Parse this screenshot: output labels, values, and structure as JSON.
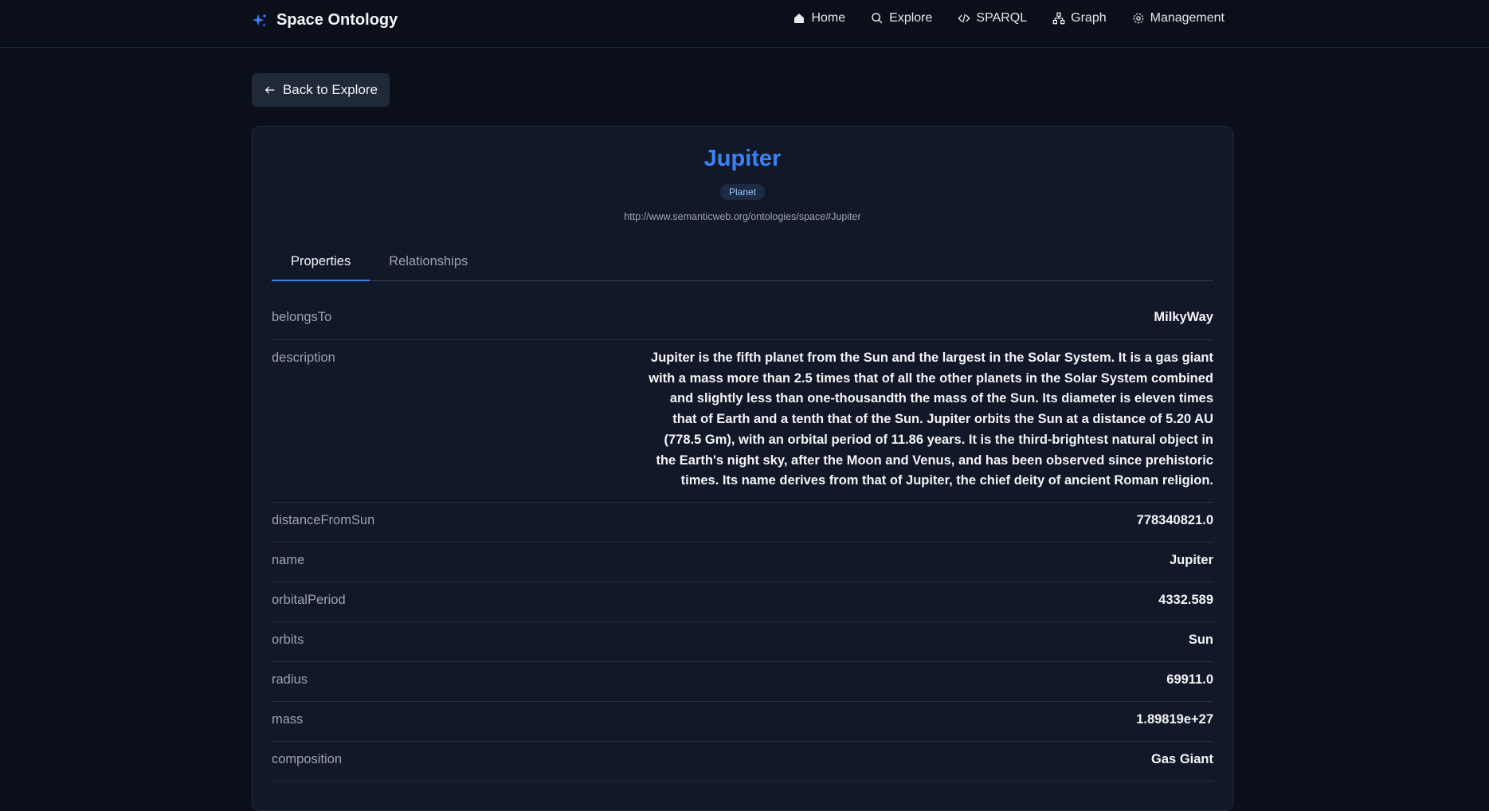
{
  "app": {
    "brand": "Space Ontology",
    "accent_color": "#3b82f6"
  },
  "nav": {
    "items": [
      {
        "label": "Home",
        "icon": "home-icon"
      },
      {
        "label": "Explore",
        "icon": "search-icon"
      },
      {
        "label": "SPARQL",
        "icon": "code-icon"
      },
      {
        "label": "Graph",
        "icon": "graph-icon"
      },
      {
        "label": "Management",
        "icon": "gear-icon"
      }
    ]
  },
  "back_button": {
    "label": "Back to Explore",
    "icon": "arrow-left-icon"
  },
  "entity": {
    "title": "Jupiter",
    "type_badge": "Planet",
    "uri": "http://www.semanticweb.org/ontologies/space#Jupiter"
  },
  "tabs": [
    {
      "label": "Properties",
      "active": true
    },
    {
      "label": "Relationships",
      "active": false
    }
  ],
  "properties": [
    {
      "key": "belongsTo",
      "value": "MilkyWay"
    },
    {
      "key": "description",
      "value": "Jupiter is the fifth planet from the Sun and the largest in the Solar System. It is a gas giant with a mass more than 2.5 times that of all the other planets in the Solar System combined and slightly less than one-thousandth the mass of the Sun. Its diameter is eleven times that of Earth and a tenth that of the Sun. Jupiter orbits the Sun at a distance of 5.20 AU (778.5 Gm), with an orbital period of 11.86 years. It is the third-brightest natural object in the Earth's night sky, after the Moon and Venus, and has been observed since prehistoric times. Its name derives from that of Jupiter, the chief deity of ancient Roman religion."
    },
    {
      "key": "distanceFromSun",
      "value": "778340821.0"
    },
    {
      "key": "name",
      "value": "Jupiter"
    },
    {
      "key": "orbitalPeriod",
      "value": "4332.589"
    },
    {
      "key": "orbits",
      "value": "Sun"
    },
    {
      "key": "radius",
      "value": "69911.0"
    },
    {
      "key": "mass",
      "value": "1.89819e+27"
    },
    {
      "key": "composition",
      "value": "Gas Giant"
    }
  ]
}
